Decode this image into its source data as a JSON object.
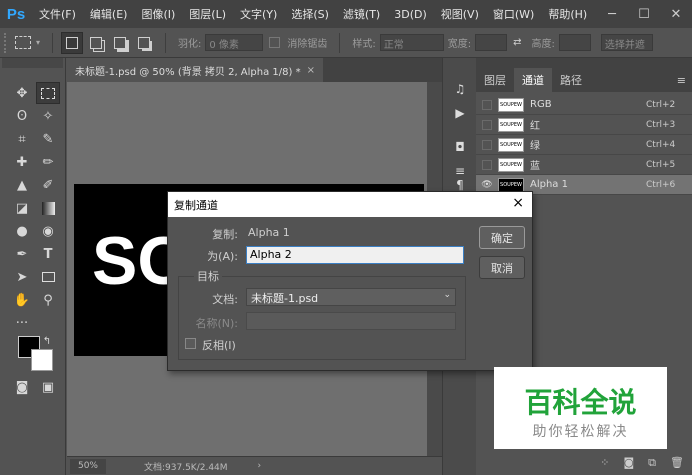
{
  "app": {
    "logo": "Ps",
    "menu": [
      "文件(F)",
      "编辑(E)",
      "图像(I)",
      "图层(L)",
      "文字(Y)",
      "选择(S)",
      "滤镜(T)",
      "3D(D)",
      "视图(V)",
      "窗口(W)",
      "帮助(H)"
    ],
    "window_controls": [
      "minimize-icon",
      "maximize-icon",
      "close-icon"
    ]
  },
  "options_bar": {
    "feather_label": "羽化:",
    "feather_value": "0 像素",
    "antialias_label": "消除锯齿",
    "style_label": "样式:",
    "style_value": "正常",
    "width_label": "宽度:",
    "height_label": "高度:",
    "select_and_mask": "选择并遮"
  },
  "document": {
    "tab_title": "未标题-1.psd @ 50% (背景 拷贝 2, Alpha 1/8) *",
    "tab_close": "×",
    "image_text": "SO",
    "zoom": "50%",
    "doc_info": "文档:937.5K/2.44M",
    "status_arrow": "›"
  },
  "channels_panel": {
    "tabs": [
      "图层",
      "通道",
      "路径"
    ],
    "active_tab": "通道",
    "menu_icon": "≡",
    "channels": [
      {
        "name": "RGB",
        "shortcut": "Ctrl+2",
        "thumb": "SOUPEW"
      },
      {
        "name": "红",
        "shortcut": "Ctrl+3",
        "thumb": "SOUPEW"
      },
      {
        "name": "绿",
        "shortcut": "Ctrl+4",
        "thumb": "SOUPEW"
      },
      {
        "name": "蓝",
        "shortcut": "Ctrl+5",
        "thumb": "SOUPEW"
      },
      {
        "name": "Alpha 1",
        "shortcut": "Ctrl+6",
        "thumb": "SOUPEW"
      }
    ]
  },
  "dialog": {
    "title": "复制通道",
    "close": "×",
    "source_label": "复制:",
    "source_value": "Alpha 1",
    "as_label": "为(A):",
    "as_value": "Alpha 2",
    "destination_title": "目标",
    "document_label": "文档:",
    "document_value": "未标题-1.psd",
    "name_label": "名称(N):",
    "invert_label": "反相(I)",
    "ok_label": "确定",
    "cancel_label": "取消"
  },
  "watermark": {
    "title": "百科全说",
    "subtitle": "助你轻松解决"
  },
  "colors": {
    "accent": "#31a8ff",
    "watermark_green": "#21a33a",
    "foreground": "#000000",
    "background": "#ffffff"
  }
}
